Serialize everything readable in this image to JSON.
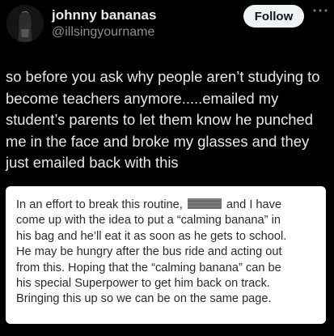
{
  "author": {
    "name": "johnny bananas",
    "handle": "@illsingyourname",
    "avatar_icon": "profile-photo"
  },
  "actions": {
    "follow_label": "Follow",
    "more_icon": "more-horizontal-icon"
  },
  "tweet": {
    "lines": [
      "so before you ask why people aren’t studying to",
      "become teachers anymore.....emailed my",
      "student’s parents to let them know he punched",
      "me in the face and broke my glasses and they",
      "just emailed back with this"
    ]
  },
  "note": {
    "line1_before": "In an effort to break this routine,",
    "line1_after": "and I have",
    "redaction_icon": "redacted-name-bar",
    "lines": [
      "come up with the idea to put a “calming banana” in",
      "his bag and he’ll eat it as soon as he gets to school.",
      "He may be hungry after the bus ride and acting out",
      "from this. Hoping that the “calming banana” can be",
      "his special Superpower to get him back on track.",
      "Bringing this up so we can be on the same page."
    ]
  },
  "colors": {
    "background": "#000000",
    "text": "#e7e9ea",
    "handle": "#8b8f94",
    "follow_bg": "#eff3f4",
    "card_bg": "#ffffff"
  }
}
